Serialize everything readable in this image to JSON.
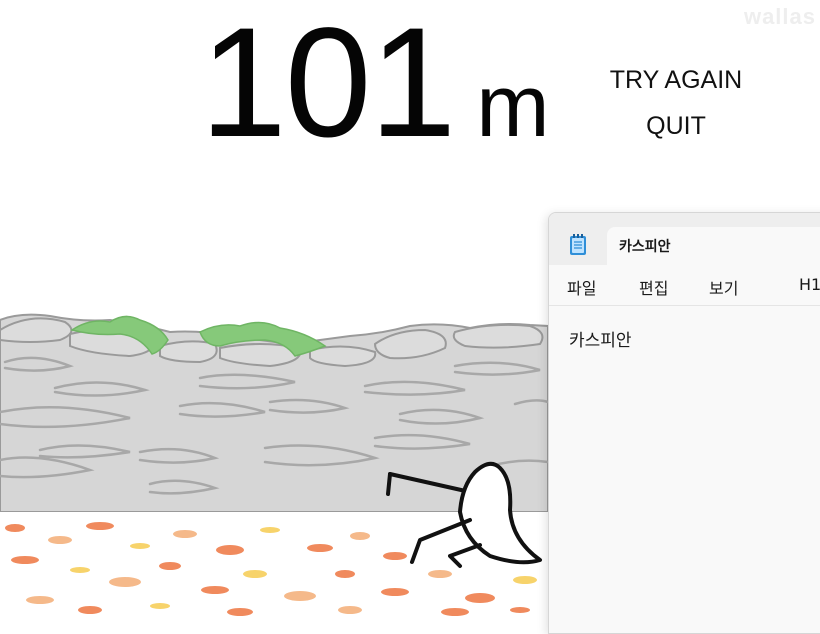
{
  "game": {
    "distance_value": "101",
    "distance_unit": "m",
    "try_again_label": "TRY AGAIN",
    "quit_label": "QUIT",
    "watermark": "wallas"
  },
  "notepad": {
    "tab_title": "카스피안",
    "menu": {
      "file": "파일",
      "edit": "편집",
      "view": "보기",
      "heading": "H1"
    },
    "content": "카스피안",
    "icon": "notepad-icon"
  },
  "colors": {
    "wall_fill": "#d6d6d6",
    "wall_stroke": "#9a9a9a",
    "moss": "#86c97a",
    "leaves": [
      "#f08a5d",
      "#f5b98a",
      "#f7d36b"
    ]
  }
}
